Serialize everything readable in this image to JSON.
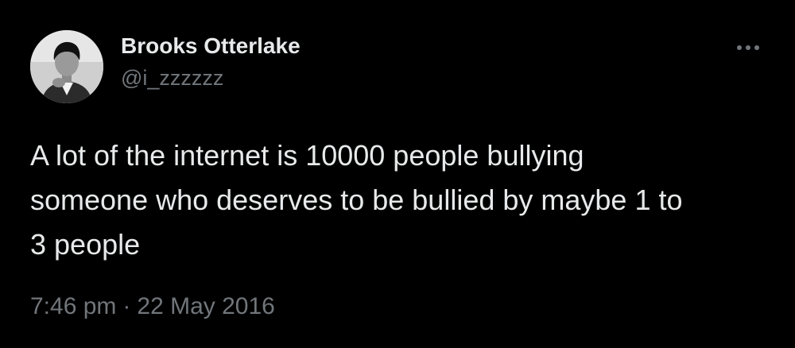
{
  "author": {
    "display_name": "Brooks Otterlake",
    "handle": "@i_zzzzzz",
    "avatar_icon": "profile-photo"
  },
  "tweet": {
    "text_lines": [
      "A lot of the internet is 10000 people bullying",
      "someone who deserves to be bullied by maybe 1 to",
      "3 people"
    ],
    "time": "7:46 pm",
    "separator": "·",
    "date": "22 May 2016"
  },
  "menu": {
    "icon": "more-horizontal-icon"
  },
  "colors": {
    "background": "#000000",
    "primary_text": "#e7e9ea",
    "secondary_text": "#71767b"
  }
}
